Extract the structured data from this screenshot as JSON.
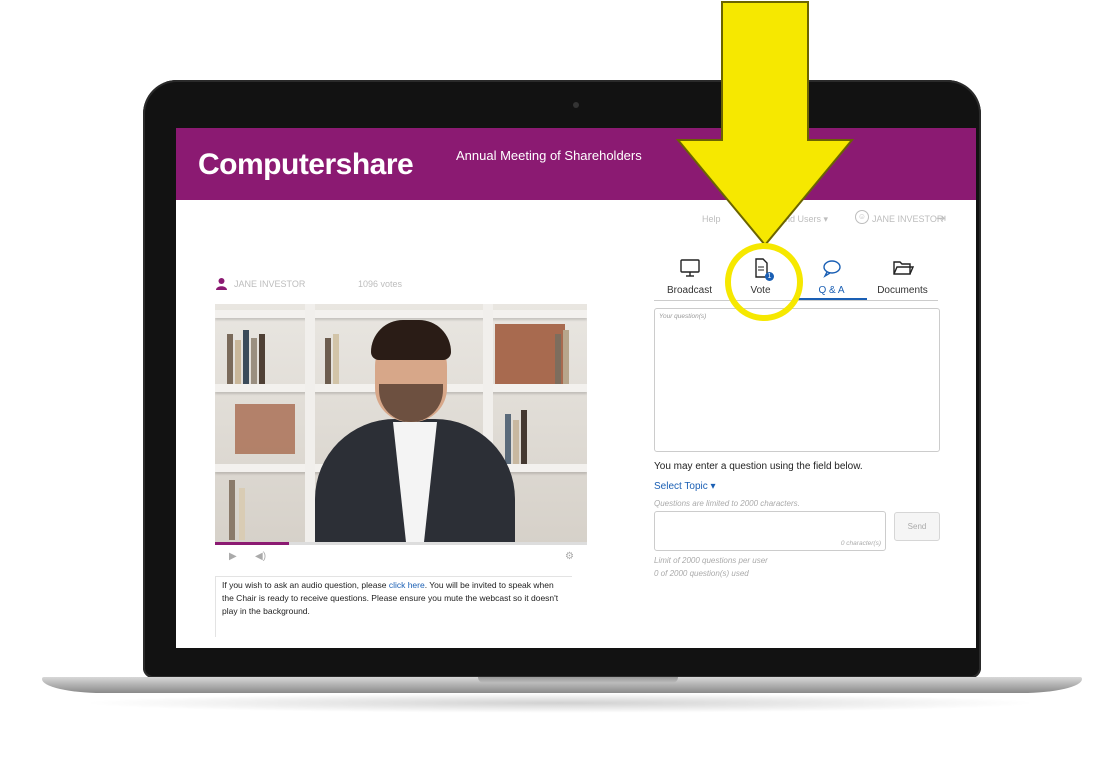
{
  "header": {
    "logo_text": "Computershare",
    "meeting_title": "Annual Meeting of Shareholders",
    "brand_color": "#8b1a72"
  },
  "topbar": {
    "help_label": "Help",
    "account_label": "and Users ▾",
    "user_name": "JANE INVESTOR",
    "logout_icon": "logout-icon"
  },
  "presenter": {
    "name": "JANE INVESTOR",
    "votes": "1096 votes"
  },
  "video": {
    "progress_fraction": 0.2,
    "controls": [
      "play-icon",
      "volume-icon",
      "settings-icon"
    ]
  },
  "audio_note": {
    "text_before": "If you wish to ask an audio question, please ",
    "link_text": "click here",
    "text_after": ". You will be invited to speak when the Chair is ready to receive questions. Please ensure you mute the webcast so it doesn't play in the background."
  },
  "tabs": [
    {
      "label": "Broadcast",
      "icon": "monitor-icon"
    },
    {
      "label": "Vote",
      "icon": "document-icon",
      "badge": "1"
    },
    {
      "label": "Q & A",
      "icon": "speech-bubble-icon",
      "active": true
    },
    {
      "label": "Documents",
      "icon": "folder-icon"
    }
  ],
  "qa": {
    "questions_placeholder": "Your question(s)",
    "entry_hint": "You may enter a question using the field below.",
    "select_topic": "Select Topic ▾",
    "char_limit_note": "Questions are limited to 2000  characters.",
    "char_counter": "0 character(s)",
    "send_label": "Send",
    "limit_per_user": "Limit of 2000 questions per user",
    "used_count": "0 of 2000 question(s) used"
  },
  "annotation": {
    "highlight_color": "#f6e800"
  }
}
